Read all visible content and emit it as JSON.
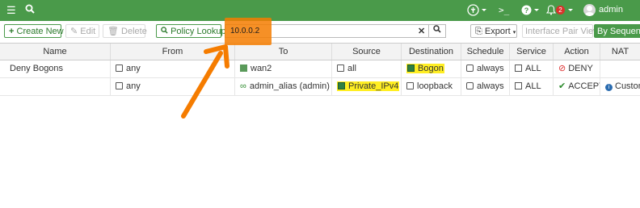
{
  "topbar": {
    "user_name": "admin",
    "notification_count": "2",
    "icons": [
      "hamburger-icon",
      "search-icon",
      "antenna-icon",
      "terminal-icon",
      "help-icon",
      "bell-icon",
      "avatar"
    ]
  },
  "toolbar": {
    "create_new": "Create New",
    "edit": "Edit",
    "delete": "Delete",
    "policy_lookup": "Policy Lookup",
    "search_value": "10.0.0.2",
    "export": "Export",
    "interface_pair_view": "Interface Pair View",
    "by_sequence": "By Sequence"
  },
  "table": {
    "columns": [
      "Name",
      "From",
      "To",
      "Source",
      "Destination",
      "Schedule",
      "Service",
      "Action",
      "NAT"
    ],
    "rows": [
      {
        "name": "Deny Bogons",
        "from": "any",
        "to": "wan2",
        "source": "all",
        "destination": "Bogon",
        "schedule": "always",
        "service": "ALL",
        "action": "DENY",
        "nat": ""
      },
      {
        "name": "",
        "from": "any",
        "to": "admin_alias (admin)",
        "source": "Private_IPv4",
        "destination": "loopback",
        "schedule": "always",
        "service": "ALL",
        "action": "ACCEPT",
        "nat": "Custom"
      }
    ]
  },
  "colors": {
    "topbar": "#4a9a4a",
    "highlight": "#ffee22",
    "annotation": "#f57c00"
  }
}
